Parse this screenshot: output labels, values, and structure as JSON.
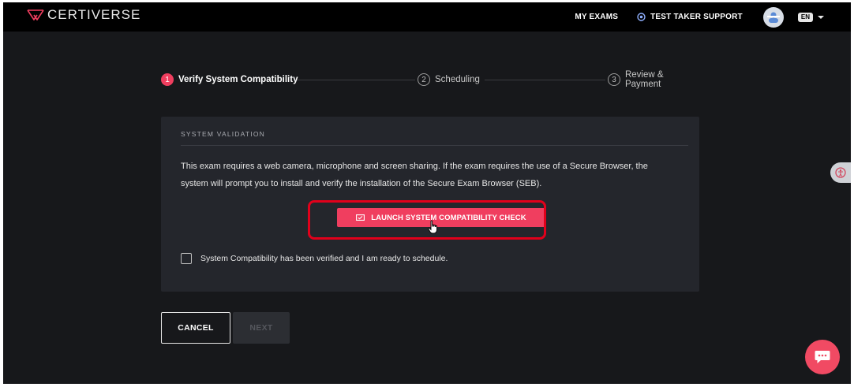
{
  "header": {
    "brand": "CERTIVERSE",
    "nav": {
      "my_exams": "MY EXAMS",
      "support": "TEST TAKER SUPPORT"
    },
    "language": "EN"
  },
  "stepper": {
    "steps": [
      {
        "number": "1",
        "label": "Verify System Compatibility",
        "state": "active"
      },
      {
        "number": "2",
        "label": "Scheduling",
        "state": "inactive"
      },
      {
        "number": "3",
        "label": "Review & Payment",
        "state": "inactive"
      }
    ]
  },
  "card": {
    "title": "SYSTEM VALIDATION",
    "description": "This exam requires a web camera, microphone and screen sharing. If the exam requires the use of a Secure Browser, the system will prompt you to install and verify the installation of the Secure Exam Browser (SEB).",
    "launch_button": "LAUNCH SYSTEM COMPATIBILITY CHECK",
    "checkbox_label": "System Compatibility has been verified and I am ready to schedule."
  },
  "actions": {
    "cancel": "CANCEL",
    "next": "NEXT"
  },
  "colors": {
    "accent": "#f03e5f",
    "highlight": "#e1001b",
    "background": "#17181b",
    "card": "#24262c"
  },
  "icons": {
    "logo": "certiverse-logo-icon",
    "support": "support-icon",
    "avatar": "avatar-icon",
    "launch": "monitor-check-icon",
    "side": "accessibility-icon",
    "chat": "chat-icon",
    "cursor": "hand-cursor-icon"
  }
}
